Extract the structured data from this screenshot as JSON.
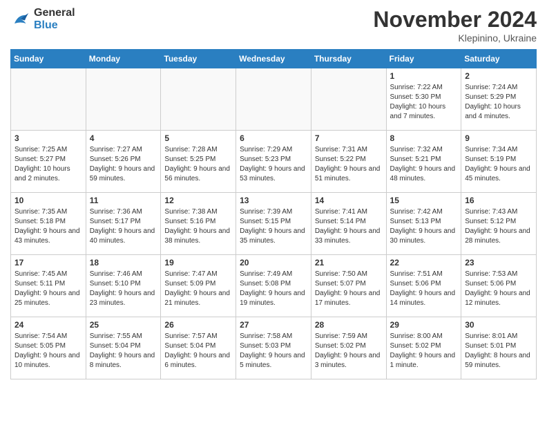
{
  "logo": {
    "line1": "General",
    "line2": "Blue"
  },
  "title": "November 2024",
  "subtitle": "Klepinino, Ukraine",
  "days_of_week": [
    "Sunday",
    "Monday",
    "Tuesday",
    "Wednesday",
    "Thursday",
    "Friday",
    "Saturday"
  ],
  "weeks": [
    [
      {
        "day": "",
        "info": ""
      },
      {
        "day": "",
        "info": ""
      },
      {
        "day": "",
        "info": ""
      },
      {
        "day": "",
        "info": ""
      },
      {
        "day": "",
        "info": ""
      },
      {
        "day": "1",
        "info": "Sunrise: 7:22 AM\nSunset: 5:30 PM\nDaylight: 10 hours and 7 minutes."
      },
      {
        "day": "2",
        "info": "Sunrise: 7:24 AM\nSunset: 5:29 PM\nDaylight: 10 hours and 4 minutes."
      }
    ],
    [
      {
        "day": "3",
        "info": "Sunrise: 7:25 AM\nSunset: 5:27 PM\nDaylight: 10 hours and 2 minutes."
      },
      {
        "day": "4",
        "info": "Sunrise: 7:27 AM\nSunset: 5:26 PM\nDaylight: 9 hours and 59 minutes."
      },
      {
        "day": "5",
        "info": "Sunrise: 7:28 AM\nSunset: 5:25 PM\nDaylight: 9 hours and 56 minutes."
      },
      {
        "day": "6",
        "info": "Sunrise: 7:29 AM\nSunset: 5:23 PM\nDaylight: 9 hours and 53 minutes."
      },
      {
        "day": "7",
        "info": "Sunrise: 7:31 AM\nSunset: 5:22 PM\nDaylight: 9 hours and 51 minutes."
      },
      {
        "day": "8",
        "info": "Sunrise: 7:32 AM\nSunset: 5:21 PM\nDaylight: 9 hours and 48 minutes."
      },
      {
        "day": "9",
        "info": "Sunrise: 7:34 AM\nSunset: 5:19 PM\nDaylight: 9 hours and 45 minutes."
      }
    ],
    [
      {
        "day": "10",
        "info": "Sunrise: 7:35 AM\nSunset: 5:18 PM\nDaylight: 9 hours and 43 minutes."
      },
      {
        "day": "11",
        "info": "Sunrise: 7:36 AM\nSunset: 5:17 PM\nDaylight: 9 hours and 40 minutes."
      },
      {
        "day": "12",
        "info": "Sunrise: 7:38 AM\nSunset: 5:16 PM\nDaylight: 9 hours and 38 minutes."
      },
      {
        "day": "13",
        "info": "Sunrise: 7:39 AM\nSunset: 5:15 PM\nDaylight: 9 hours and 35 minutes."
      },
      {
        "day": "14",
        "info": "Sunrise: 7:41 AM\nSunset: 5:14 PM\nDaylight: 9 hours and 33 minutes."
      },
      {
        "day": "15",
        "info": "Sunrise: 7:42 AM\nSunset: 5:13 PM\nDaylight: 9 hours and 30 minutes."
      },
      {
        "day": "16",
        "info": "Sunrise: 7:43 AM\nSunset: 5:12 PM\nDaylight: 9 hours and 28 minutes."
      }
    ],
    [
      {
        "day": "17",
        "info": "Sunrise: 7:45 AM\nSunset: 5:11 PM\nDaylight: 9 hours and 25 minutes."
      },
      {
        "day": "18",
        "info": "Sunrise: 7:46 AM\nSunset: 5:10 PM\nDaylight: 9 hours and 23 minutes."
      },
      {
        "day": "19",
        "info": "Sunrise: 7:47 AM\nSunset: 5:09 PM\nDaylight: 9 hours and 21 minutes."
      },
      {
        "day": "20",
        "info": "Sunrise: 7:49 AM\nSunset: 5:08 PM\nDaylight: 9 hours and 19 minutes."
      },
      {
        "day": "21",
        "info": "Sunrise: 7:50 AM\nSunset: 5:07 PM\nDaylight: 9 hours and 17 minutes."
      },
      {
        "day": "22",
        "info": "Sunrise: 7:51 AM\nSunset: 5:06 PM\nDaylight: 9 hours and 14 minutes."
      },
      {
        "day": "23",
        "info": "Sunrise: 7:53 AM\nSunset: 5:06 PM\nDaylight: 9 hours and 12 minutes."
      }
    ],
    [
      {
        "day": "24",
        "info": "Sunrise: 7:54 AM\nSunset: 5:05 PM\nDaylight: 9 hours and 10 minutes."
      },
      {
        "day": "25",
        "info": "Sunrise: 7:55 AM\nSunset: 5:04 PM\nDaylight: 9 hours and 8 minutes."
      },
      {
        "day": "26",
        "info": "Sunrise: 7:57 AM\nSunset: 5:04 PM\nDaylight: 9 hours and 6 minutes."
      },
      {
        "day": "27",
        "info": "Sunrise: 7:58 AM\nSunset: 5:03 PM\nDaylight: 9 hours and 5 minutes."
      },
      {
        "day": "28",
        "info": "Sunrise: 7:59 AM\nSunset: 5:02 PM\nDaylight: 9 hours and 3 minutes."
      },
      {
        "day": "29",
        "info": "Sunrise: 8:00 AM\nSunset: 5:02 PM\nDaylight: 9 hours and 1 minute."
      },
      {
        "day": "30",
        "info": "Sunrise: 8:01 AM\nSunset: 5:01 PM\nDaylight: 8 hours and 59 minutes."
      }
    ]
  ]
}
